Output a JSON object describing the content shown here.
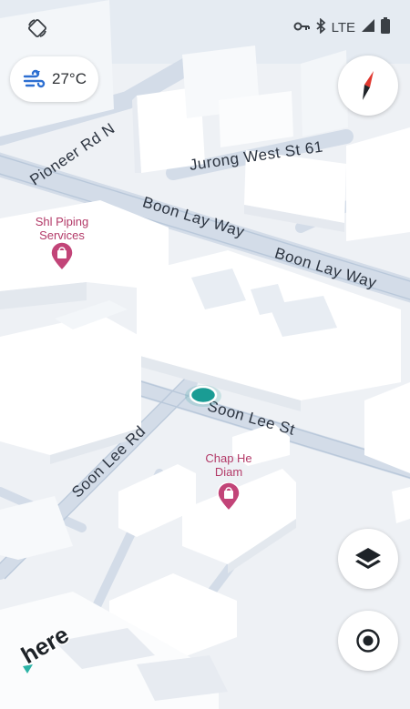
{
  "status_bar": {
    "network": "LTE"
  },
  "weather": {
    "temperature": "27°C",
    "icon": "windy-weather-icon"
  },
  "map": {
    "street_labels": [
      "Pioneer Rd N",
      "Jurong West St 61",
      "Boon Lay Way",
      "Boon Lay Way",
      "Soon Lee St",
      "Soon Lee Rd"
    ],
    "pois": [
      {
        "name_line1": "Shl Piping",
        "name_line2": "Services",
        "icon": "shopping-bag-pin-icon"
      },
      {
        "name_line1": "Chap He",
        "name_line2": "Diam",
        "icon": "shopping-bag-pin-icon"
      }
    ],
    "brand_logo_text": "here"
  },
  "controls": {
    "compass_icon": "compass-icon",
    "layers_icon": "layers-icon",
    "locate_icon": "my-location-icon"
  },
  "colors": {
    "poi_pink": "#c24478",
    "location_teal": "#1a9c94",
    "compass_red": "#e0382f"
  }
}
